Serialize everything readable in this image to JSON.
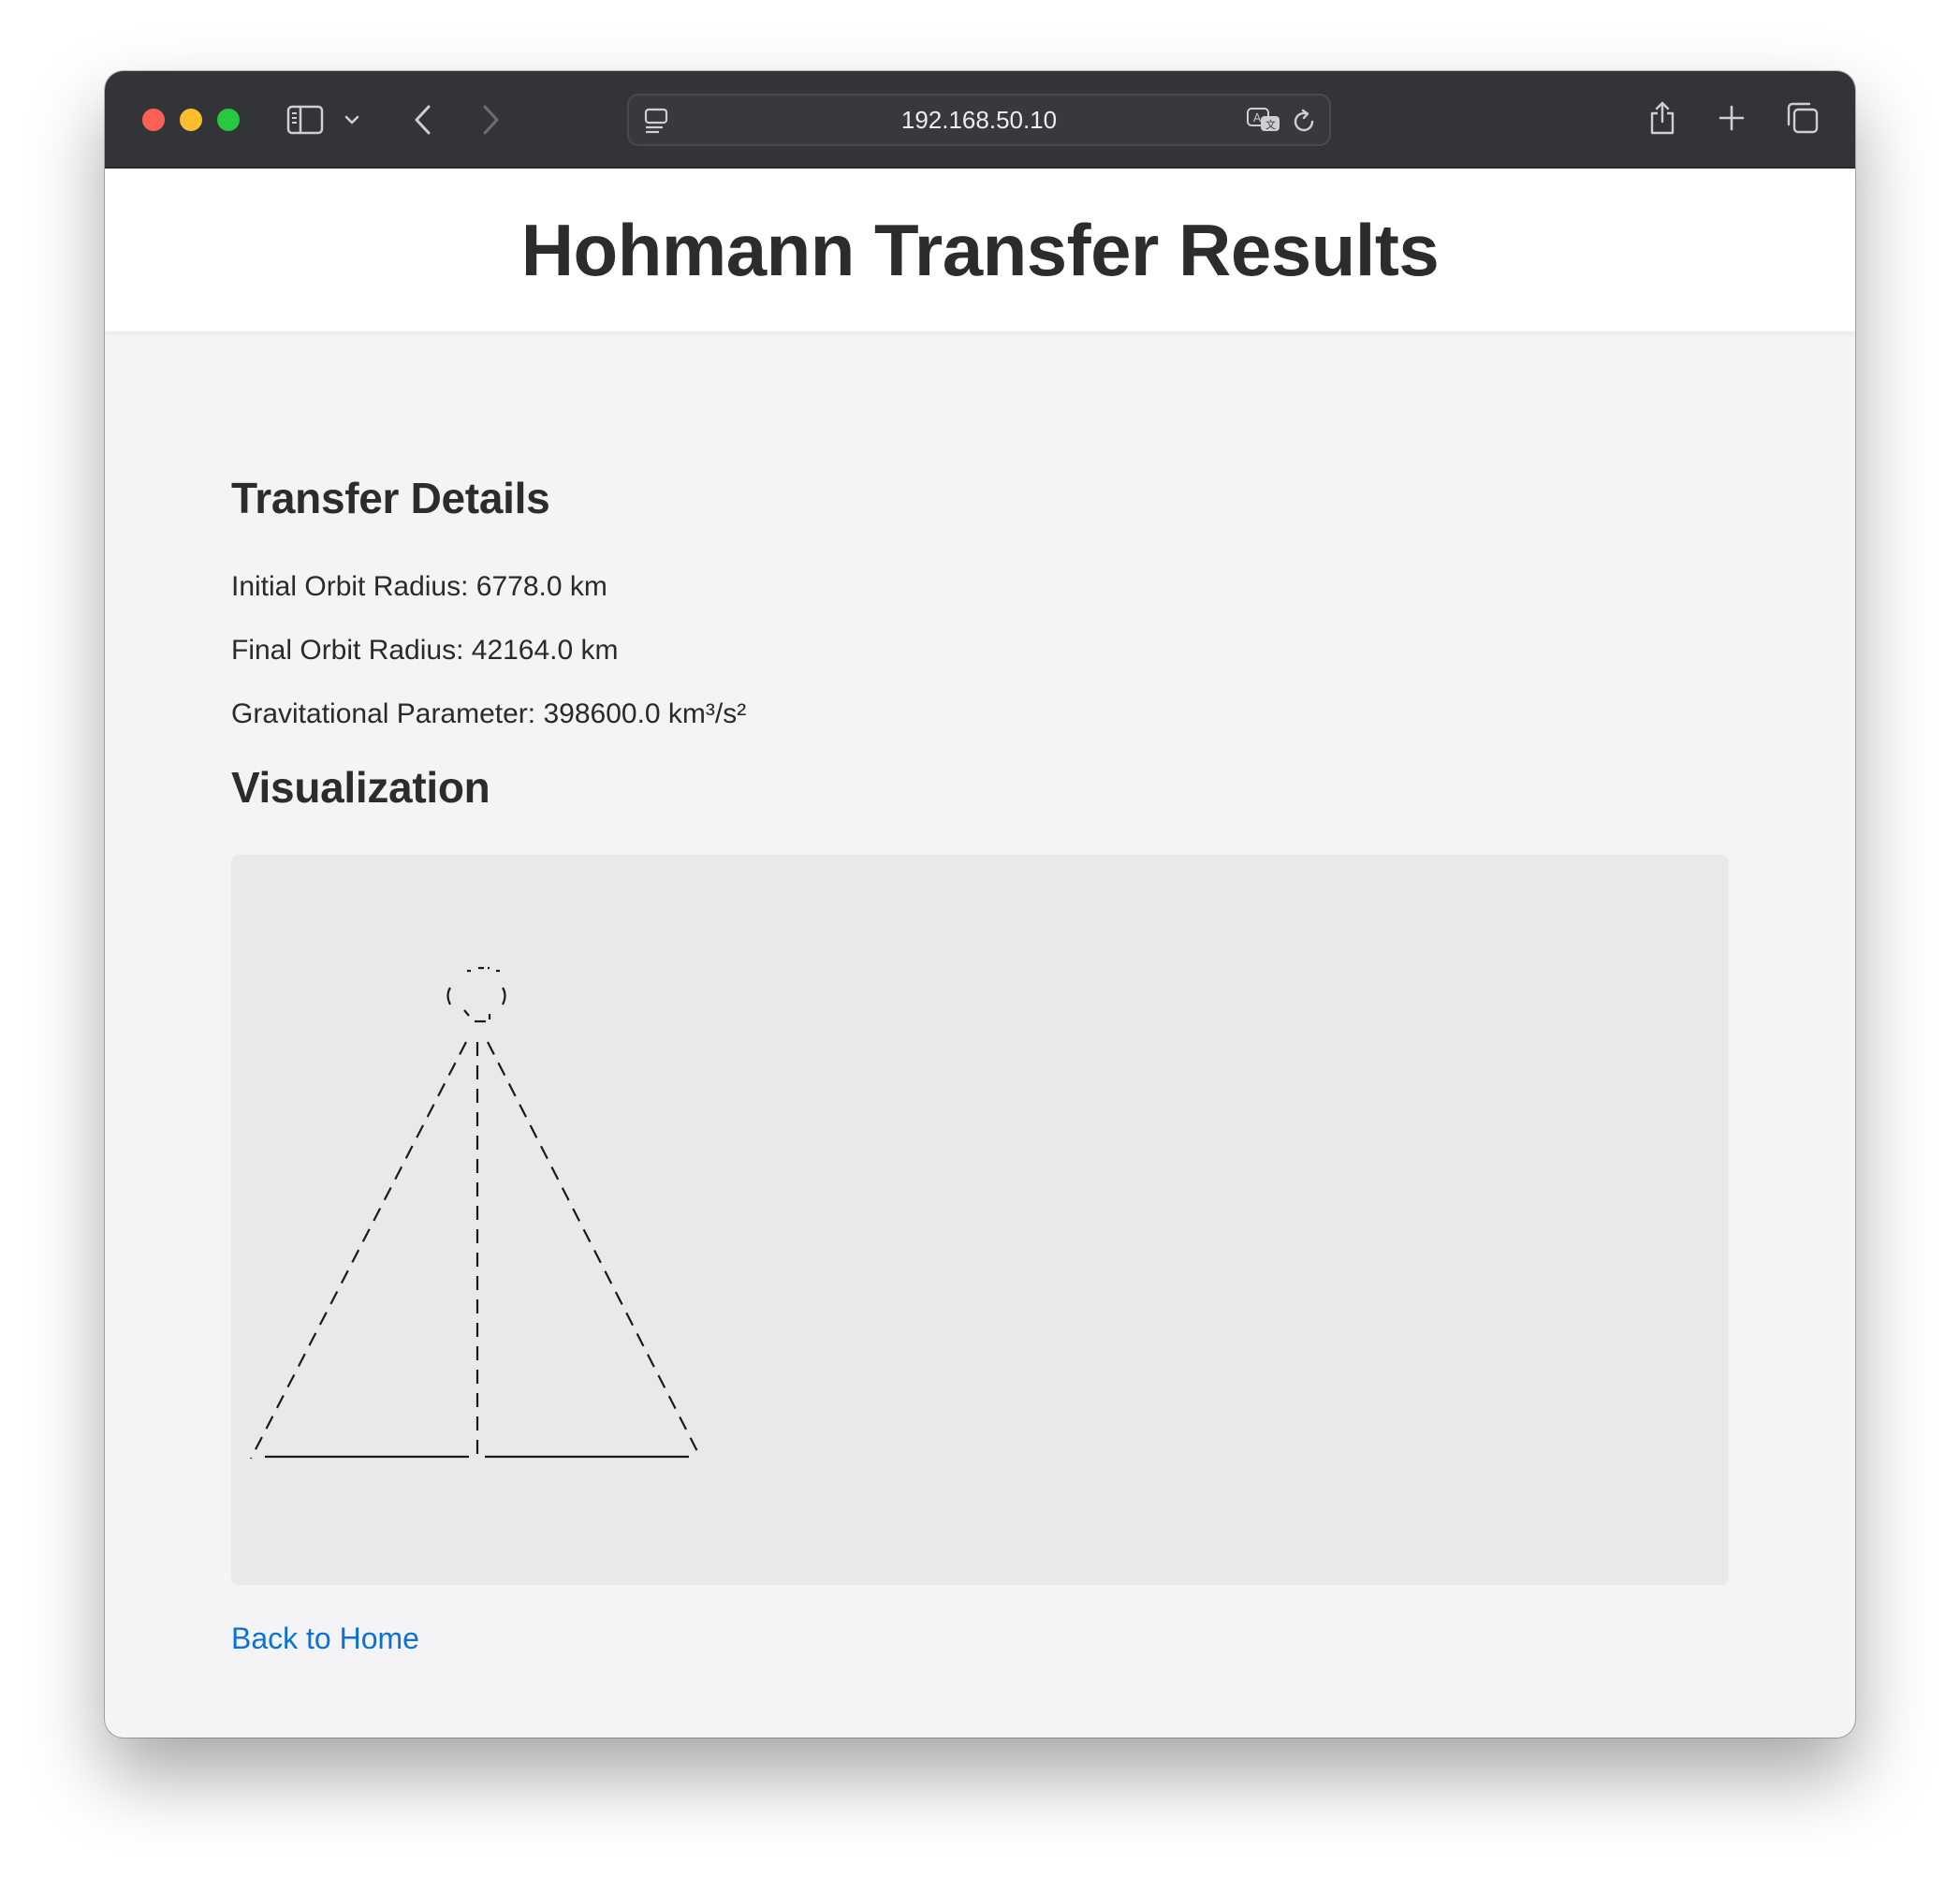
{
  "browser": {
    "url": "192.168.50.10",
    "icons": [
      "sidebar-icon",
      "chevron-down-icon",
      "back-icon",
      "forward-icon",
      "page-menu-icon",
      "translate-icon",
      "reload-icon",
      "share-icon",
      "new-tab-icon",
      "tabs-overview-icon"
    ]
  },
  "page": {
    "title": "Hohmann Transfer Results",
    "details_heading": "Transfer Details",
    "initial_orbit": "Initial Orbit Radius: 6778.0 km",
    "final_orbit": "Final Orbit Radius: 42164.0 km",
    "grav_param": "Gravitational Parameter: 398600.0 km³/s²",
    "vis_heading": "Visualization",
    "back_link": "Back to Home"
  },
  "colors": {
    "link": "#0a72d6",
    "page_bg": "#f4f4f6",
    "vis_bg": "#e9e9ea"
  }
}
